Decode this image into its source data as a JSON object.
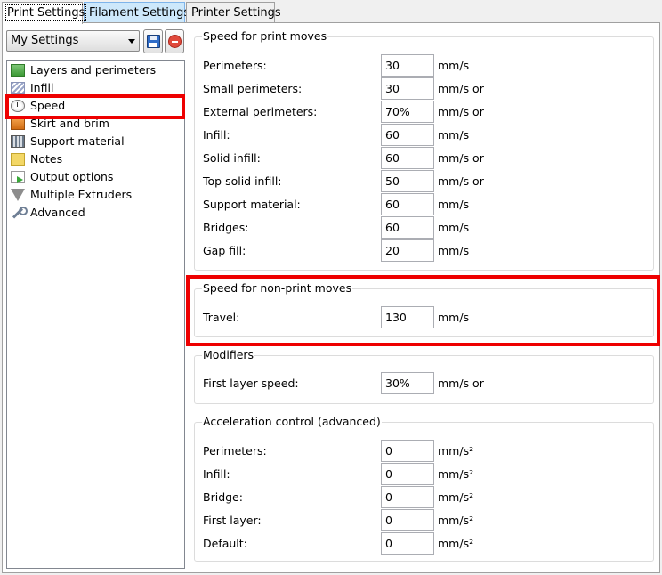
{
  "tabs": [
    {
      "label": "Print Settings"
    },
    {
      "label": "Filament Settings"
    },
    {
      "label": "Printer Settings"
    }
  ],
  "preset": {
    "selected": "My Settings"
  },
  "sidebar": {
    "items": [
      {
        "label": "Layers and perimeters",
        "icon": "layers-icon"
      },
      {
        "label": "Infill",
        "icon": "infill-icon"
      },
      {
        "label": "Speed",
        "icon": "speed-icon"
      },
      {
        "label": "Skirt and brim",
        "icon": "skirt-icon"
      },
      {
        "label": "Support material",
        "icon": "support-icon"
      },
      {
        "label": "Notes",
        "icon": "notes-icon"
      },
      {
        "label": "Output options",
        "icon": "output-icon"
      },
      {
        "label": "Multiple Extruders",
        "icon": "funnel-icon"
      },
      {
        "label": "Advanced",
        "icon": "wrench-icon"
      }
    ],
    "selected": "Speed"
  },
  "groups": {
    "print_moves": {
      "title": "Speed for print moves",
      "rows": [
        {
          "label": "Perimeters:",
          "value": "30",
          "unit": "mm/s"
        },
        {
          "label": "Small perimeters:",
          "value": "30",
          "unit": "mm/s or"
        },
        {
          "label": "External perimeters:",
          "value": "70%",
          "unit": "mm/s or"
        },
        {
          "label": "Infill:",
          "value": "60",
          "unit": "mm/s"
        },
        {
          "label": "Solid infill:",
          "value": "60",
          "unit": "mm/s or"
        },
        {
          "label": "Top solid infill:",
          "value": "50",
          "unit": "mm/s or"
        },
        {
          "label": "Support material:",
          "value": "60",
          "unit": "mm/s"
        },
        {
          "label": "Bridges:",
          "value": "60",
          "unit": "mm/s"
        },
        {
          "label": "Gap fill:",
          "value": "20",
          "unit": "mm/s"
        }
      ]
    },
    "non_print_moves": {
      "title": "Speed for non-print moves",
      "rows": [
        {
          "label": "Travel:",
          "value": "130",
          "unit": "mm/s"
        }
      ]
    },
    "modifiers": {
      "title": "Modifiers",
      "rows": [
        {
          "label": "First layer speed:",
          "value": "30%",
          "unit": "mm/s or"
        }
      ]
    },
    "acceleration": {
      "title": "Acceleration control (advanced)",
      "rows": [
        {
          "label": "Perimeters:",
          "value": "0",
          "unit": "mm/s²"
        },
        {
          "label": "Infill:",
          "value": "0",
          "unit": "mm/s²"
        },
        {
          "label": "Bridge:",
          "value": "0",
          "unit": "mm/s²"
        },
        {
          "label": "First layer:",
          "value": "0",
          "unit": "mm/s²"
        },
        {
          "label": "Default:",
          "value": "0",
          "unit": "mm/s²"
        }
      ]
    }
  },
  "colors": {
    "highlight": "#ee0000",
    "active_tab_blue": "#cde8fb"
  }
}
